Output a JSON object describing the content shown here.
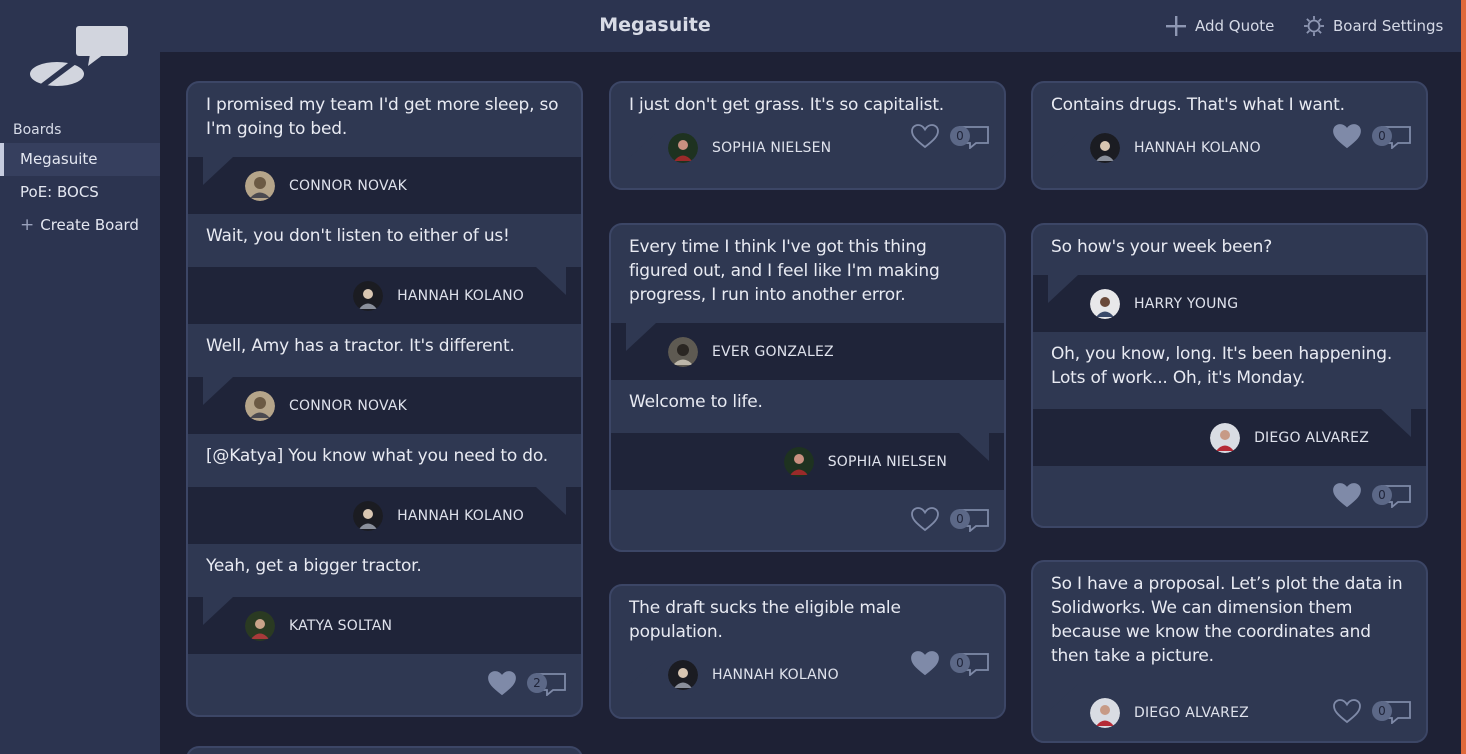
{
  "app": {
    "title": "Megasuite"
  },
  "header": {
    "add_quote": "Add Quote",
    "board_settings": "Board Settings"
  },
  "sidebar": {
    "boards_label": "Boards",
    "items": [
      {
        "label": "Megasuite",
        "active": true
      },
      {
        "label": "PoE: BOCS",
        "active": false
      }
    ],
    "create_label": "Create Board"
  },
  "cards": [
    {
      "quotes": [
        {
          "text": "I promised my team I'd get more sleep, so I'm going to bed.",
          "author": "CONNOR NOVAK"
        },
        {
          "text": "Wait, you don't listen to either of us!",
          "author": "HANNAH KOLANO"
        },
        {
          "text": "Well, Amy has a tractor. It's different.",
          "author": "CONNOR NOVAK"
        },
        {
          "text": "[@Katya] You know what you need to do.",
          "author": "HANNAH KOLANO"
        },
        {
          "text": "Yeah, get a bigger tractor.",
          "author": "KATYA SOLTAN"
        }
      ],
      "liked": true,
      "comments": "2"
    },
    {
      "quotes": [
        {
          "text": "I just don't get grass. It's so capitalist.",
          "author": "SOPHIA NIELSEN"
        }
      ],
      "liked": false,
      "comments": "0"
    },
    {
      "quotes": [
        {
          "text": "Every time I think I've got this thing figured out, and I feel like I'm making progress, I run into another error.",
          "author": "EVER GONZALEZ"
        },
        {
          "text": "Welcome to life.",
          "author": "SOPHIA NIELSEN"
        }
      ],
      "liked": false,
      "comments": "0"
    },
    {
      "quotes": [
        {
          "text": "The draft sucks the eligible male population.",
          "author": "HANNAH KOLANO"
        }
      ],
      "liked": true,
      "comments": "0"
    },
    {
      "quotes": [
        {
          "text": "Contains drugs. That's what I want.",
          "author": "HANNAH KOLANO"
        }
      ],
      "liked": true,
      "comments": "0"
    },
    {
      "quotes": [
        {
          "text": "So how's your week been?",
          "author": "HARRY YOUNG"
        },
        {
          "text": "Oh, you know, long. It's been happening. Lots of work... Oh, it's Monday.",
          "author": "DIEGO ALVAREZ"
        }
      ],
      "liked": true,
      "comments": "0"
    },
    {
      "quotes": [
        {
          "text": "So I have a proposal. Let’s plot the data in Solidworks. We can dimension them because we know the coordinates and then take a picture.",
          "author": "DIEGO ALVAREZ"
        }
      ],
      "liked": false,
      "comments": "0"
    }
  ],
  "colors": {
    "background": "#1e2135",
    "panel": "#2c3450",
    "card": "#2f3852",
    "attribution": "#1f2439",
    "icon": "#7f8aa8",
    "accent_edge": "#e0693b"
  },
  "icons": {
    "logo": "quote-bubbles-logo",
    "add": "plus-icon",
    "settings": "gear-icon",
    "like": "heart-icon",
    "comment": "comment-icon"
  }
}
